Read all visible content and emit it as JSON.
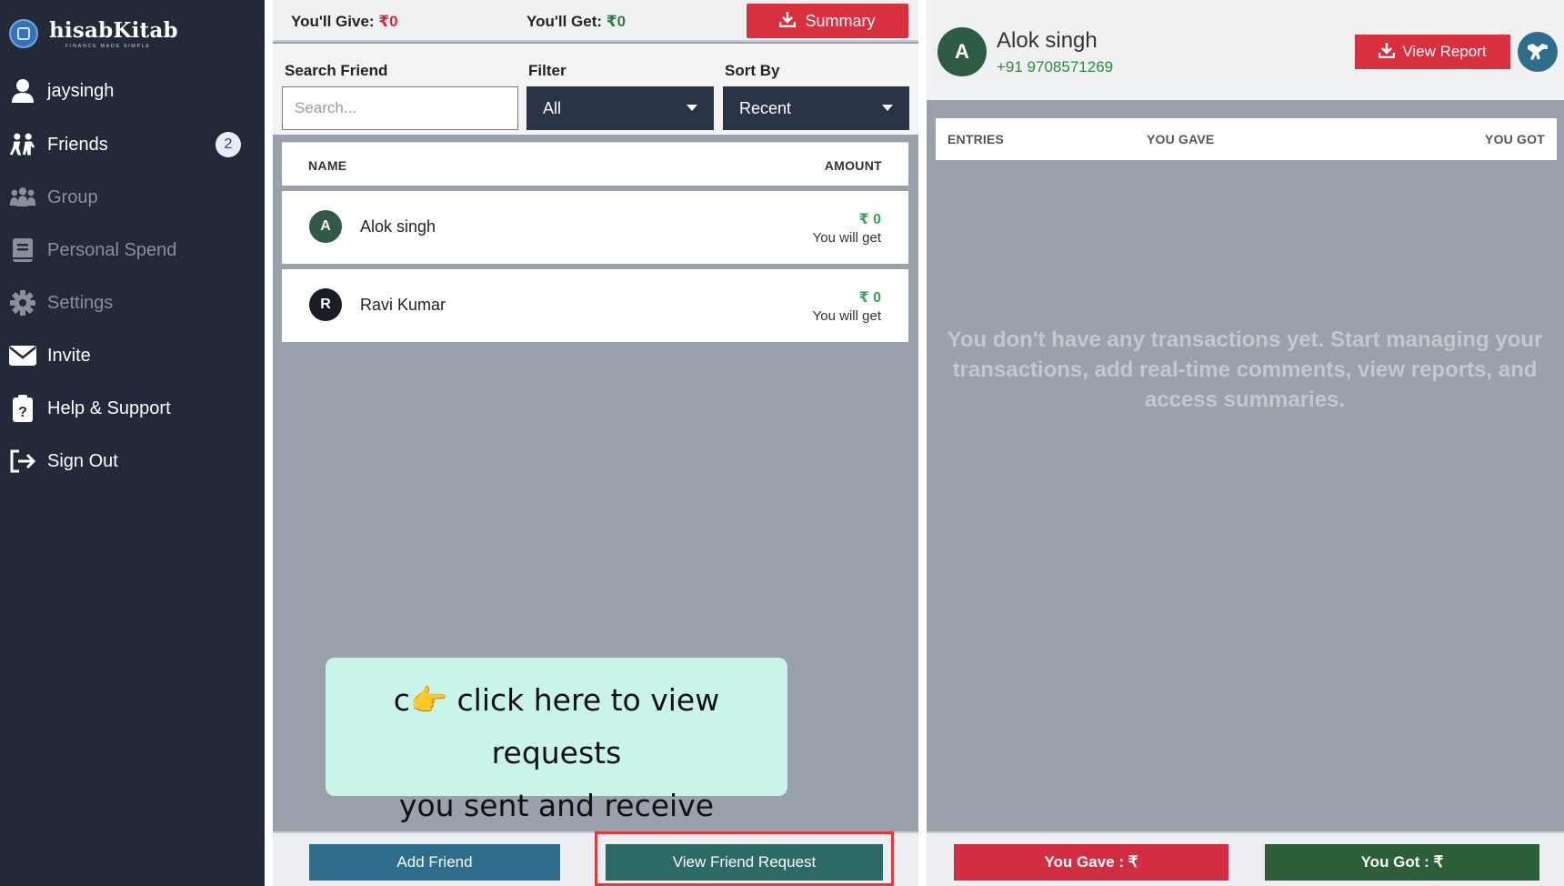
{
  "app": {
    "name": "hisabKitab",
    "tagline": "FINANCE MADE SIMPLE"
  },
  "sidebar": {
    "items": [
      {
        "label": "jaysingh",
        "icon": "user-icon"
      },
      {
        "label": "Friends",
        "icon": "friends-icon",
        "badge": "2"
      },
      {
        "label": "Group",
        "icon": "group-icon"
      },
      {
        "label": "Personal Spend",
        "icon": "book-icon"
      },
      {
        "label": "Settings",
        "icon": "gear-icon"
      },
      {
        "label": "Invite",
        "icon": "envelope-icon"
      },
      {
        "label": "Help & Support",
        "icon": "clipboard-question-icon"
      },
      {
        "label": "Sign Out",
        "icon": "sign-out-icon"
      }
    ]
  },
  "friends_panel": {
    "give_label": "You'll Give:",
    "give_value": "₹0",
    "get_label": "You'll Get:",
    "get_value": "₹0",
    "summary_label": "Summary",
    "search_label": "Search Friend",
    "search_placeholder": "Search...",
    "filter_label": "Filter",
    "filter_value": "All",
    "sort_label": "Sort By",
    "sort_value": "Recent",
    "columns": {
      "name": "NAME",
      "amount": "AMOUNT"
    },
    "friends": [
      {
        "initial": "A",
        "name": "Alok singh",
        "amount": "₹ 0",
        "note": "You will get",
        "avatar_color": "#2e5b43"
      },
      {
        "initial": "R",
        "name": "Ravi Kumar",
        "amount": "₹ 0",
        "note": "You will get",
        "avatar_color": "#1b1d26"
      }
    ],
    "hint": {
      "emoji": "👉",
      "prefix": "c",
      "line1": "click here to view requests",
      "line2": "you sent and receive"
    },
    "add_friend_label": "Add Friend",
    "view_request_label": "View Friend Request"
  },
  "detail_panel": {
    "initial": "A",
    "name": "Alok singh",
    "phone": "+91 9708571269",
    "view_report_label": "View Report",
    "columns": {
      "entries": "ENTRIES",
      "gave": "YOU GAVE",
      "got": "YOU GOT"
    },
    "empty_message": "You don't have any transactions yet. Start managing your transactions, add real-time comments, view reports, and access summaries.",
    "you_gave_label": "You Gave : ₹",
    "you_got_label": "You Got : ₹"
  },
  "colors": {
    "sidebar_bg": "#222a3a",
    "accent_red": "#d9303f",
    "accent_green": "#2e7d3e",
    "panel_gray": "#9aa1ac"
  }
}
